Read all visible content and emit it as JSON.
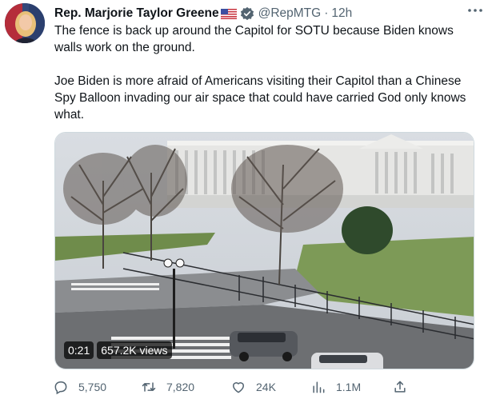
{
  "author": {
    "name": "Rep. Marjorie Taylor Greene",
    "flag_icon": "us-flag-emoji",
    "verified_icon": "verified-badge-icon",
    "handle": "@RepMTG",
    "separator": "·",
    "time": "12h"
  },
  "tweet": {
    "text": "The fence is back up around the Capitol for SOTU because Biden knows walls work on the ground.\n\nJoe Biden is more afraid of Americans visiting their Capitol than a Chinese Spy Balloon invading our air space that could have carried God only knows what."
  },
  "video": {
    "duration": "0:21",
    "views": "657.2K views"
  },
  "actions": {
    "replies": "5,750",
    "retweets": "7,820",
    "likes": "24K",
    "views": "1.1M"
  },
  "colors": {
    "text": "#0f1419",
    "secondary": "#536471",
    "verified": "#1d9bf0",
    "border": "#cfd9de"
  }
}
